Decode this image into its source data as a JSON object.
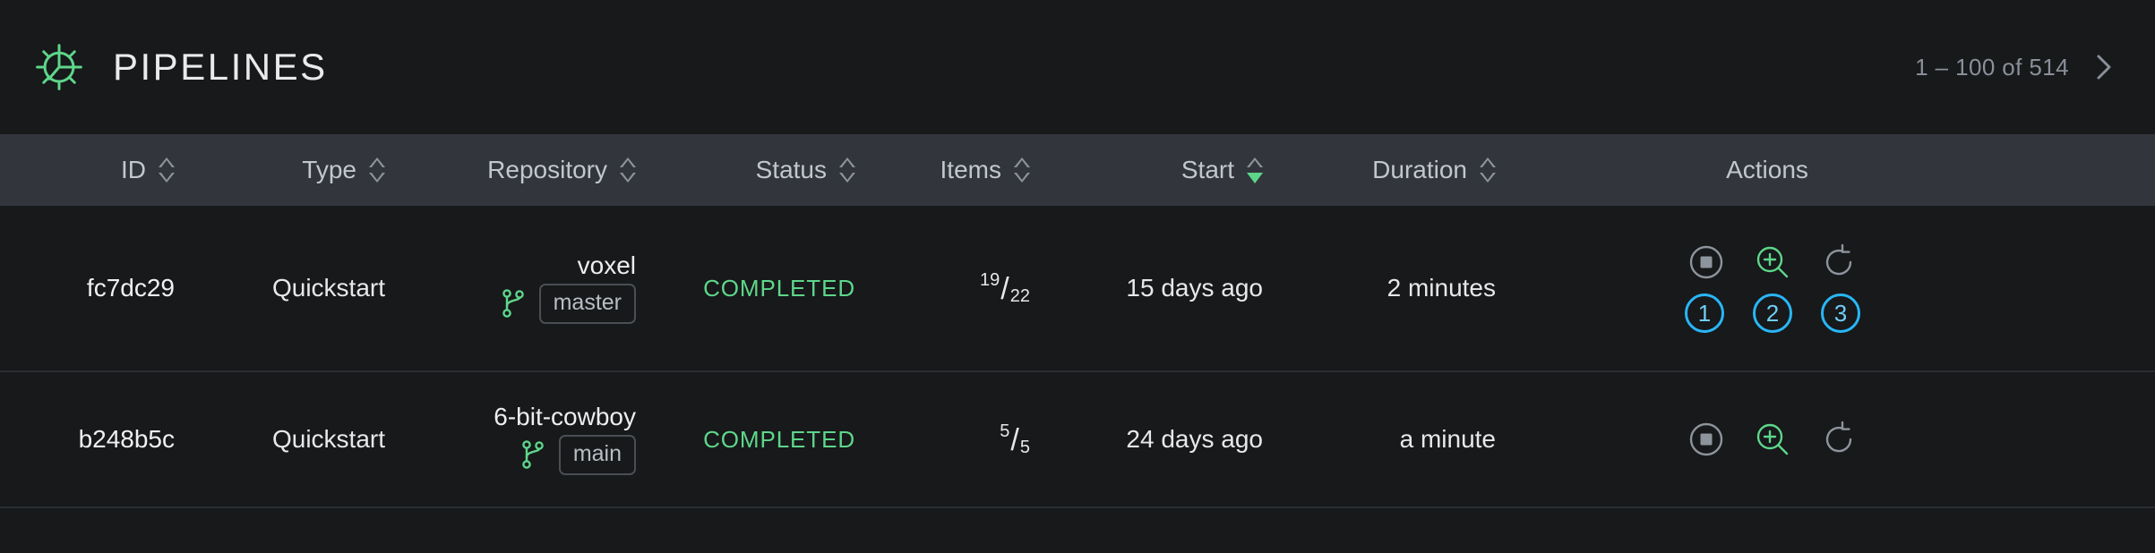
{
  "header": {
    "logo_icon": "gear-icon",
    "title": "PIPELINES",
    "pagination": {
      "label": "1 – 100 of 514",
      "next_icon": "chevron-right-icon"
    }
  },
  "colors": {
    "background": "#17191b",
    "header_band": "#32363c",
    "accent_green": "#5ed68a",
    "text_primary": "#e6e8ea",
    "text_muted": "#8a9099",
    "annotation_blue": "#29b6f6",
    "icon_gray": "#8d949c"
  },
  "table": {
    "columns": [
      {
        "label": "ID",
        "sortable": true,
        "sort_state": "none"
      },
      {
        "label": "Type",
        "sortable": true,
        "sort_state": "none"
      },
      {
        "label": "Repository",
        "sortable": true,
        "sort_state": "none"
      },
      {
        "label": "Status",
        "sortable": true,
        "sort_state": "none"
      },
      {
        "label": "Items",
        "sortable": true,
        "sort_state": "none"
      },
      {
        "label": "Start",
        "sortable": true,
        "sort_state": "desc"
      },
      {
        "label": "Duration",
        "sortable": true,
        "sort_state": "none"
      },
      {
        "label": "Actions",
        "sortable": false,
        "sort_state": "none"
      }
    ],
    "rows": [
      {
        "id": "fc7dc29",
        "type": "Quickstart",
        "repository": "voxel",
        "branch": "master",
        "status": "COMPLETED",
        "items_done": "19",
        "items_total": "22",
        "start": "15 days ago",
        "duration": "2 minutes",
        "actions": [
          {
            "name": "stop-button",
            "icon": "stop-circle-icon",
            "annotation": "1"
          },
          {
            "name": "inspect-button",
            "icon": "zoom-in-icon",
            "annotation": "2"
          },
          {
            "name": "retry-button",
            "icon": "refresh-icon",
            "annotation": "3"
          }
        ],
        "has_annotations": true
      },
      {
        "id": "b248b5c",
        "type": "Quickstart",
        "repository": "6-bit-cowboy",
        "branch": "main",
        "status": "COMPLETED",
        "items_done": "5",
        "items_total": "5",
        "start": "24 days ago",
        "duration": "a minute",
        "actions": [
          {
            "name": "stop-button",
            "icon": "stop-circle-icon",
            "annotation": ""
          },
          {
            "name": "inspect-button",
            "icon": "zoom-in-icon",
            "annotation": ""
          },
          {
            "name": "retry-button",
            "icon": "refresh-icon",
            "annotation": ""
          }
        ],
        "has_annotations": false
      }
    ]
  }
}
